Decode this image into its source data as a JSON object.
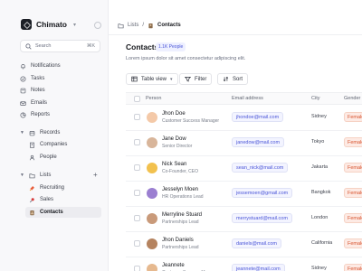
{
  "app": {
    "name": "Chimato"
  },
  "search": {
    "placeholder": "Search",
    "shortcut": "⌘K"
  },
  "nav": {
    "primary": [
      {
        "label": "Notifications",
        "icon": "bell-icon"
      },
      {
        "label": "Tasks",
        "icon": "check-circle-icon"
      },
      {
        "label": "Notes",
        "icon": "note-icon"
      },
      {
        "label": "Emails",
        "icon": "mail-icon"
      },
      {
        "label": "Reports",
        "icon": "chart-icon"
      }
    ],
    "records": {
      "label": "Records",
      "items": [
        {
          "label": "Companies",
          "icon": "building-icon"
        },
        {
          "label": "People",
          "icon": "user-icon"
        }
      ]
    },
    "lists": {
      "label": "Lists",
      "items": [
        {
          "label": "Recruiting",
          "icon": "rocket-icon"
        },
        {
          "label": "Sales",
          "icon": "pin-icon"
        },
        {
          "label": "Contacts",
          "icon": "contacts-icon"
        }
      ]
    }
  },
  "breadcrumb": {
    "parent": "Lists",
    "separator": "/",
    "current": "Contacts"
  },
  "header": {
    "title": "Contacts",
    "badge": "1.1K People",
    "subtitle": "Lorem ipsum dolor sit amet consectetur adipiscing elit."
  },
  "toolbar": {
    "view": "Table view",
    "filter": "Filter",
    "sort": "Sort"
  },
  "table": {
    "headers": {
      "person": "Person",
      "email": "Email address",
      "city": "City",
      "gender": "Gender"
    },
    "rows": [
      {
        "name": "Jhon Doe",
        "role": "Customer Success Manager",
        "email": "jhondoe@mail.com",
        "city": "Sidney",
        "gender": "Female",
        "avatar_color": "#f4c9a8"
      },
      {
        "name": "Jane Dow",
        "role": "Senior Director",
        "email": "janedow@mail.com",
        "city": "Tokyo",
        "gender": "Female",
        "avatar_color": "#d8b59a"
      },
      {
        "name": "Nick Sean",
        "role": "Co-Founder, CEO",
        "email": "sean_nick@mail.com",
        "city": "Jakarta",
        "gender": "Female",
        "avatar_color": "#f2c14e"
      },
      {
        "name": "Jesselyn Moen",
        "role": "HR Operations Lead",
        "email": "jessemoen@gmail.com",
        "city": "Bangkok",
        "gender": "Female",
        "avatar_color": "#9b7fd1"
      },
      {
        "name": "Merryline Stuard",
        "role": "Partnerships Lead",
        "email": "merrystuard@mail.com",
        "city": "London",
        "gender": "Female",
        "avatar_color": "#c99a7a"
      },
      {
        "name": "Jhon Daniels",
        "role": "Partnerships Lead",
        "email": "daniels@mail.com",
        "city": "California",
        "gender": "Female",
        "avatar_color": "#b5835f"
      },
      {
        "name": "Jeannete",
        "role": "Customer Success Manager",
        "email": "jeannete@mail.com",
        "city": "Sidney",
        "gender": "Female",
        "avatar_color": "#e6b98f"
      }
    ]
  },
  "colors": {
    "accent": "#4a55d8",
    "female_badge": "#d8542f"
  }
}
